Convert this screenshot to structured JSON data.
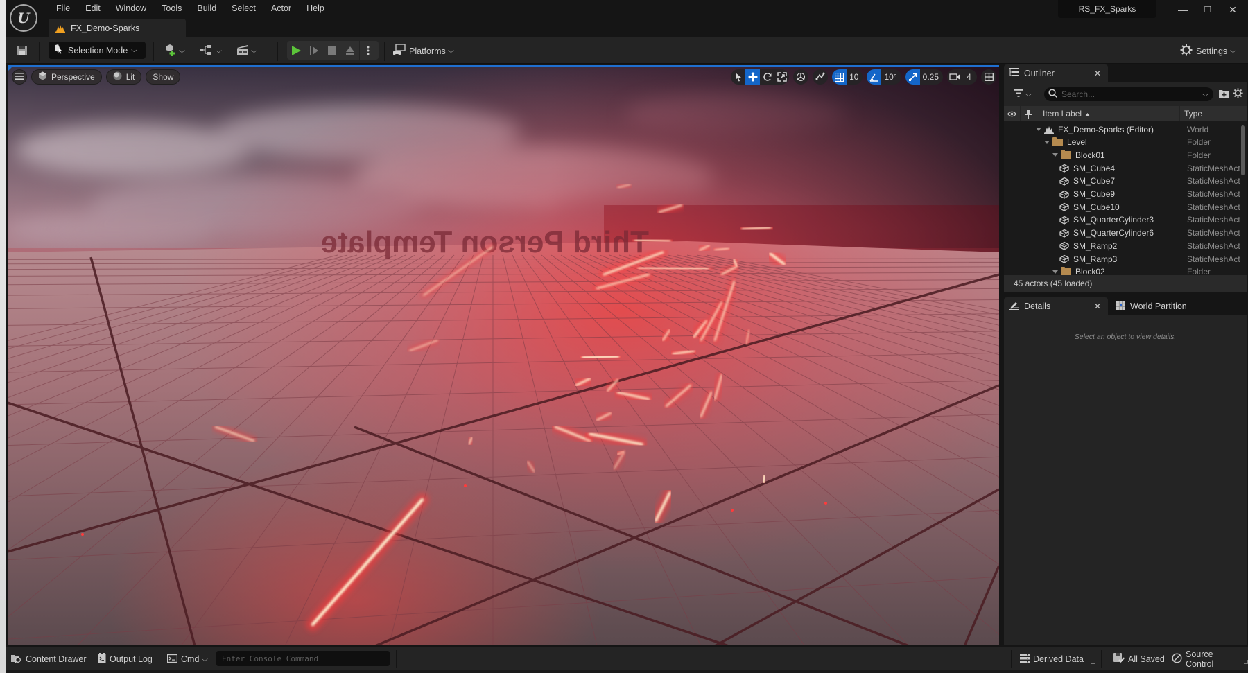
{
  "app": {
    "logo": "U",
    "project_name": "RS_FX_Sparks",
    "window_controls": {
      "minimize": "—",
      "restore": "❐",
      "close": "✕"
    }
  },
  "menu": [
    "File",
    "Edit",
    "Window",
    "Tools",
    "Build",
    "Select",
    "Actor",
    "Help"
  ],
  "document_tab": {
    "label": "FX_Demo-Sparks",
    "icon": "level-icon"
  },
  "toolbar": {
    "save_icon": "save-icon",
    "selection_mode_label": "Selection Mode",
    "add_icon": "add-actor-icon",
    "blueprint_icon": "blueprint-icon",
    "cinematics_icon": "cinematics-icon",
    "play_icons": [
      "play-icon",
      "advance-frame-icon",
      "stop-icon",
      "eject-icon",
      "more-options-icon"
    ],
    "platforms_label": "Platforms",
    "settings_label": "Settings"
  },
  "viewport": {
    "menu_icon": "hamburger-menu-icon",
    "view_mode_label": "Perspective",
    "lit_label": "Lit",
    "show_label": "Show",
    "grid_snap_value": "10",
    "rotation_snap_value": "10°",
    "scale_snap_value": "0.25",
    "camera_speed_value": "4",
    "scene_text": "Third Person Template",
    "scene_text_mirrored": true,
    "spark_color": "#ff3b3b",
    "spark_core_color": "#fff1d0"
  },
  "outliner": {
    "tab_label": "Outliner",
    "close": "✕",
    "search_placeholder": "Search...",
    "columns": {
      "label": "Item Label",
      "type": "Type"
    },
    "rows": [
      {
        "label": "FX_Demo-Sparks (Editor)",
        "type": "World",
        "kind": "world",
        "depth": 0
      },
      {
        "label": "Level",
        "type": "Folder",
        "kind": "folder",
        "depth": 1
      },
      {
        "label": "Block01",
        "type": "Folder",
        "kind": "folder",
        "depth": 2
      },
      {
        "label": "SM_Cube4",
        "type": "StaticMeshActor",
        "kind": "mesh",
        "depth": 3
      },
      {
        "label": "SM_Cube7",
        "type": "StaticMeshActor",
        "kind": "mesh",
        "depth": 3
      },
      {
        "label": "SM_Cube9",
        "type": "StaticMeshActor",
        "kind": "mesh",
        "depth": 3
      },
      {
        "label": "SM_Cube10",
        "type": "StaticMeshActor",
        "kind": "mesh",
        "depth": 3
      },
      {
        "label": "SM_QuarterCylinder3",
        "type": "StaticMeshActor",
        "kind": "mesh",
        "depth": 3
      },
      {
        "label": "SM_QuarterCylinder6",
        "type": "StaticMeshActor",
        "kind": "mesh",
        "depth": 3
      },
      {
        "label": "SM_Ramp2",
        "type": "StaticMeshActor",
        "kind": "mesh",
        "depth": 3
      },
      {
        "label": "SM_Ramp3",
        "type": "StaticMeshActor",
        "kind": "mesh",
        "depth": 3
      },
      {
        "label": "Block02",
        "type": "Folder",
        "kind": "folder",
        "depth": 2
      }
    ],
    "actor_count": "45 actors (45 loaded)"
  },
  "details": {
    "tab_label": "Details",
    "close": "✕",
    "world_partition_label": "World Partition",
    "empty_message": "Select an object to view details."
  },
  "statusbar": {
    "content_drawer": "Content Drawer",
    "output_log": "Output Log",
    "cmd": "Cmd",
    "console_placeholder": "Enter Console Command",
    "derived_data": "Derived Data",
    "all_saved": "All Saved",
    "source_control": "Source Control"
  }
}
